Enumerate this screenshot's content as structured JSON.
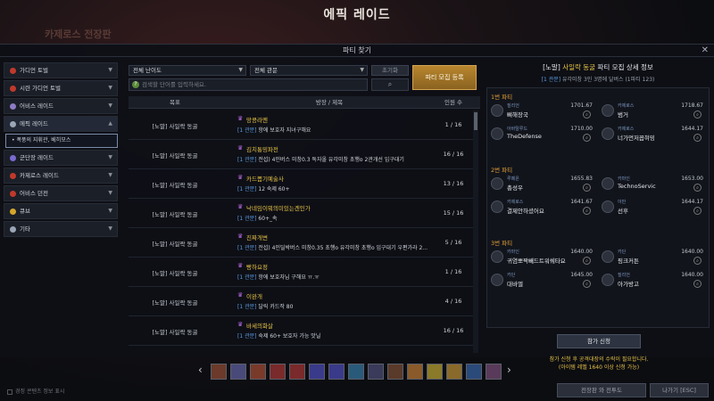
{
  "window_title": "에픽 레이드",
  "bg_label": "카제로스 전장판",
  "panel_title": "파티 찾기",
  "close_icon": "close-icon",
  "sidebar": {
    "items": [
      {
        "label": "가디언 토벌",
        "icon": "guardian-icon",
        "color": "#c0392b"
      },
      {
        "label": "시련 가디언 토벌",
        "icon": "trial-guardian-icon",
        "color": "#c0392b"
      },
      {
        "label": "어비스 레이드",
        "icon": "abyss-raid-icon",
        "color": "#8e7cc3"
      },
      {
        "label": "에픽 레이드",
        "icon": "epic-raid-icon",
        "color": "#9aa5b5"
      },
      {
        "label": "군단장 레이드",
        "icon": "commander-raid-icon",
        "color": "#7a6ad0"
      },
      {
        "label": "카제로스 레이드",
        "icon": "kazeros-raid-icon",
        "color": "#c0392b"
      },
      {
        "label": "어비스 던전",
        "icon": "abyss-dungeon-icon",
        "color": "#c0392b"
      },
      {
        "label": "큐브",
        "icon": "cube-icon",
        "color": "#d4a62a"
      },
      {
        "label": "기타",
        "icon": "more-icon",
        "color": "#9aa5b5"
      }
    ],
    "sub_item": "• 폭풍의 지휘관, 베히모스"
  },
  "filters": {
    "difficulty": "전체 난이도",
    "type": "전체 관문",
    "reset": "초기화",
    "search_placeholder": "검색할 단어를 입력하세요.",
    "recruit": "파티 모집 등록"
  },
  "table": {
    "headers": [
      "목표",
      "방장 / 제목",
      "인원 수"
    ],
    "rows": [
      {
        "target": "[노말] 사일락 동굴",
        "leader": "망콩라멘",
        "tag": "[1 관문]",
        "title": "항에 보호자 지녀구해요",
        "count": "1 / 16"
      },
      {
        "target": "[노말] 사일락 동굴",
        "leader": "김치통밍파전",
        "tag": "[1 관문]",
        "title": "전섭) 4인버스 미창0.3 독자올 유각미창 초행o 2관개선 입구대기",
        "count": "16 / 16"
      },
      {
        "target": "[노말] 사일락 동굴",
        "leader": "카드뽑기예술사",
        "tag": "[1 관문]",
        "title": "12 숙제 60+",
        "count": "13 / 16"
      },
      {
        "target": "[노말] 사일락 동굴",
        "leader": "낙네임이뭐의미있는겐인가",
        "tag": "[1 관문]",
        "title": "60+_속",
        "count": "15 / 16"
      },
      {
        "target": "[노말] 사일락 동굴",
        "leader": "진짜개변",
        "tag": "[1 관문]",
        "title": "전섭) 4인딜박버스 미창0.35 초행o 유각미창 초행o 입구대기 우편가라 2...",
        "count": "5 / 16"
      },
      {
        "target": "[노말] 사일락 동굴",
        "leader": "빵하요정",
        "tag": "[1 관문]",
        "title": "항에 보호자님 구해요 ㅠ.ㅠ",
        "count": "1 / 16"
      },
      {
        "target": "[노말] 사일락 동굴",
        "leader": "이완개",
        "tag": "[1 관문]",
        "title": "달릭 카드작 80",
        "count": "4 / 16"
      },
      {
        "target": "[노말] 사일락 동굴",
        "leader": "바세의화살",
        "tag": "[1 관문]",
        "title": "숙제 60+ 보호자 가능 맛닐",
        "count": "16 / 16"
      }
    ]
  },
  "detail": {
    "title_pre": "[노말]",
    "title_gold": "사일락 동굴",
    "title_post": "파티 모집 상세 정보",
    "sub_tag": "[1 관문]",
    "sub_text": "유각미창 3인 3명에 달버스 (1파티 123)",
    "parties": [
      {
        "label": "1번 파티",
        "members": [
          {
            "cls": "질리언",
            "name": "뼈해장국",
            "il": "1701.67"
          },
          {
            "cls": "카제로스",
            "name": "범거",
            "il": "1718.67"
          },
          {
            "cls": "아바탈루드",
            "name": "TheDefense",
            "il": "1710.00"
          },
          {
            "cls": "카제로스",
            "name": "너가먼저꼽혀밍",
            "il": "1644.17"
          }
        ]
      },
      {
        "label": "2번 파티",
        "members": [
          {
            "cls": "루페온",
            "name": "총성우",
            "il": "1655.83"
          },
          {
            "cls": "카마인",
            "name": "TechnoServic",
            "il": "1653.00"
          },
          {
            "cls": "카제로스",
            "name": "결제안하셨어요",
            "il": "1641.67"
          },
          {
            "cls": "아만",
            "name": "선후",
            "il": "1644.17"
          }
        ]
      },
      {
        "label": "3번 파티",
        "members": [
          {
            "cls": "카마인",
            "name": "귀염뽀짝빼드트워쉐타요",
            "il": "1640.00"
          },
          {
            "cls": "카단",
            "name": "핑크커튼",
            "il": "1640.00"
          },
          {
            "cls": "카단",
            "name": "대바엘",
            "il": "1645.00"
          },
          {
            "cls": "질리언",
            "name": "아가방고",
            "il": "1640.00"
          }
        ]
      }
    ],
    "notice1": "참가 신청 후 공격대장의 수락이 필요합니다.",
    "notice2": "(아이템 레벨 1640 이상 신청 가능)",
    "apply": "참가 신청"
  },
  "bottom": {
    "checkbox": "경정 콘텐츠 정보 표시",
    "btn1": "전장판 와 전투도",
    "btn2": "나가기 [ESC]"
  }
}
